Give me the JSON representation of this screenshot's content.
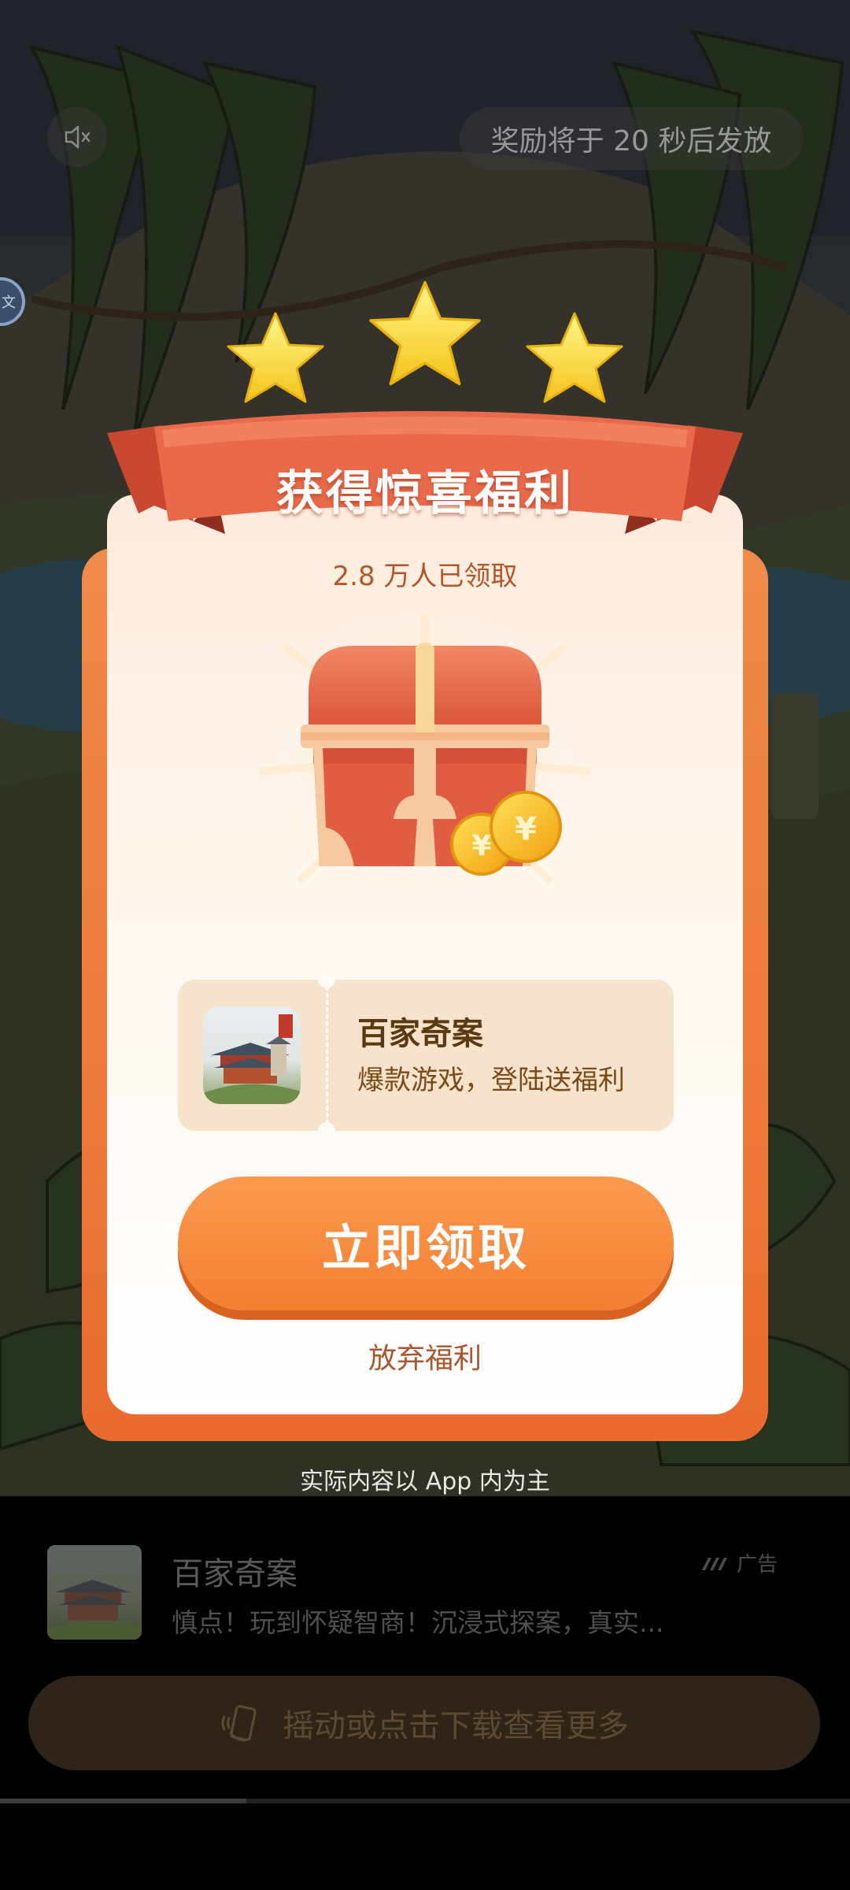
{
  "top_bar": {
    "mute_icon": "speaker-muted-icon",
    "reward_timer_text": "奖励将于 20 秒后发放"
  },
  "side_badge_text": "文",
  "card": {
    "title": "获得惊喜福利",
    "claimed_text": "2.8 万人已领取",
    "game": {
      "name": "百家奇案",
      "tagline": "爆款游戏，登陆送福利"
    },
    "claim_button": "立即领取",
    "give_up": "放弃福利"
  },
  "disclaimer": "实际内容以 App 内为主",
  "ad": {
    "title": "百家奇案",
    "description": "慎点！玩到怀疑智商！沉浸式探案，真实...",
    "tag": "广告",
    "download_button": "摇动或点击下载查看更多"
  },
  "progress": {
    "fraction": 0.29
  },
  "colors": {
    "accent": "#f47f32",
    "ribbon": "#e96a4a",
    "title_text": "#ffffff",
    "claimed_text": "#b3552b"
  }
}
